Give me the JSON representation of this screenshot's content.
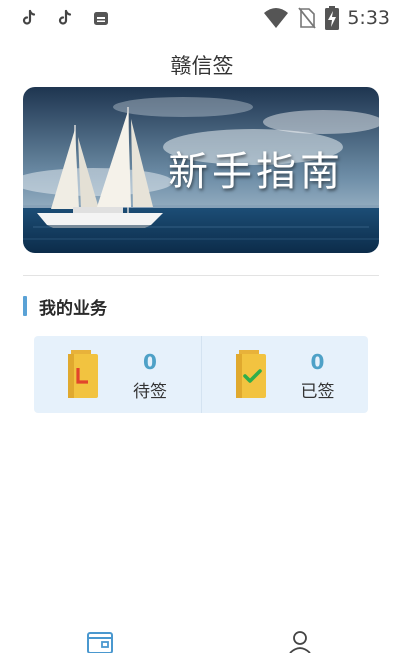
{
  "status_bar": {
    "time": "5:33",
    "left_icons": [
      "tiktok-icon",
      "tiktok-icon",
      "shop-icon"
    ],
    "right_icons": [
      "wifi-icon",
      "no-sim-icon",
      "battery-charging-icon"
    ]
  },
  "app": {
    "title": "赣信签"
  },
  "banner": {
    "text": "新手指南"
  },
  "business": {
    "section_title": "我的业务",
    "cards": [
      {
        "count": "0",
        "label": "待签",
        "icon": "pending-document-icon"
      },
      {
        "count": "0",
        "label": "已签",
        "icon": "signed-document-icon"
      }
    ]
  },
  "tab_bar": {
    "tabs": [
      {
        "icon": "home-icon",
        "active": true
      },
      {
        "icon": "profile-icon",
        "active": false
      }
    ]
  },
  "colors": {
    "accent": "#5aa2d6",
    "count": "#4ea1c7",
    "card_bg": "#e6f1fb"
  }
}
